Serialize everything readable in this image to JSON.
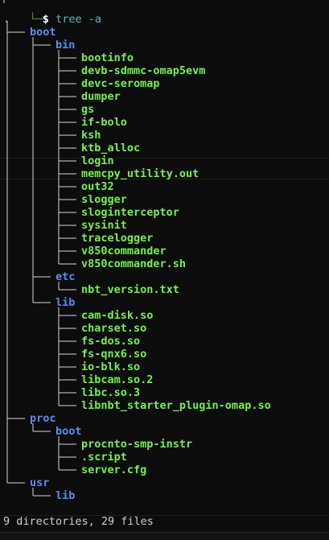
{
  "prompt": {
    "corner": "└─",
    "symbol": "$",
    "command": "tree -a"
  },
  "tree": {
    "root": ".",
    "nodes": [
      {
        "name": "boot",
        "kind": "dir",
        "depth": 1
      },
      {
        "name": "bin",
        "kind": "dir",
        "depth": 2
      },
      {
        "name": "bootinfo",
        "kind": "file",
        "depth": 3
      },
      {
        "name": "devb-sdmmc-omap5evm",
        "kind": "file",
        "depth": 3
      },
      {
        "name": "devc-seromap",
        "kind": "file",
        "depth": 3
      },
      {
        "name": "dumper",
        "kind": "file",
        "depth": 3
      },
      {
        "name": "gs",
        "kind": "file",
        "depth": 3
      },
      {
        "name": "if-bolo",
        "kind": "file",
        "depth": 3
      },
      {
        "name": "ksh",
        "kind": "file",
        "depth": 3
      },
      {
        "name": "ktb_alloc",
        "kind": "file",
        "depth": 3
      },
      {
        "name": "login",
        "kind": "file",
        "depth": 3
      },
      {
        "name": "memcpy_utility.out",
        "kind": "file",
        "depth": 3
      },
      {
        "name": "out32",
        "kind": "file",
        "depth": 3
      },
      {
        "name": "slogger",
        "kind": "file",
        "depth": 3
      },
      {
        "name": "sloginterceptor",
        "kind": "file",
        "depth": 3
      },
      {
        "name": "sysinit",
        "kind": "file",
        "depth": 3
      },
      {
        "name": "tracelogger",
        "kind": "file",
        "depth": 3
      },
      {
        "name": "v850commander",
        "kind": "file",
        "depth": 3
      },
      {
        "name": "v850commander.sh",
        "kind": "file",
        "depth": 3
      },
      {
        "name": "etc",
        "kind": "dir",
        "depth": 2
      },
      {
        "name": "nbt_version.txt",
        "kind": "file",
        "depth": 3
      },
      {
        "name": "lib",
        "kind": "dir",
        "depth": 2
      },
      {
        "name": "cam-disk.so",
        "kind": "file",
        "depth": 3
      },
      {
        "name": "charset.so",
        "kind": "file",
        "depth": 3
      },
      {
        "name": "fs-dos.so",
        "kind": "file",
        "depth": 3
      },
      {
        "name": "fs-qnx6.so",
        "kind": "file",
        "depth": 3
      },
      {
        "name": "io-blk.so",
        "kind": "file",
        "depth": 3
      },
      {
        "name": "libcam.so.2",
        "kind": "file",
        "depth": 3
      },
      {
        "name": "libc.so.3",
        "kind": "file",
        "depth": 3
      },
      {
        "name": "libnbt_starter_plugin-omap.so",
        "kind": "file",
        "depth": 3
      },
      {
        "name": "proc",
        "kind": "dir",
        "depth": 1
      },
      {
        "name": "boot",
        "kind": "dir",
        "depth": 2
      },
      {
        "name": "procnto-smp-instr",
        "kind": "file",
        "depth": 3
      },
      {
        "name": ".script",
        "kind": "file",
        "depth": 3
      },
      {
        "name": "server.cfg",
        "kind": "file",
        "depth": 3
      },
      {
        "name": "usr",
        "kind": "dir",
        "depth": 1
      },
      {
        "name": "lib",
        "kind": "dir",
        "depth": 2
      }
    ]
  },
  "summary": "9 directories, 29 files",
  "colors": {
    "background": "#0c0c0c",
    "directory": "#5b8cf0",
    "file": "#73f24a",
    "prompt_command": "#56b6c2",
    "tree_lines": "#d8d8d8"
  }
}
